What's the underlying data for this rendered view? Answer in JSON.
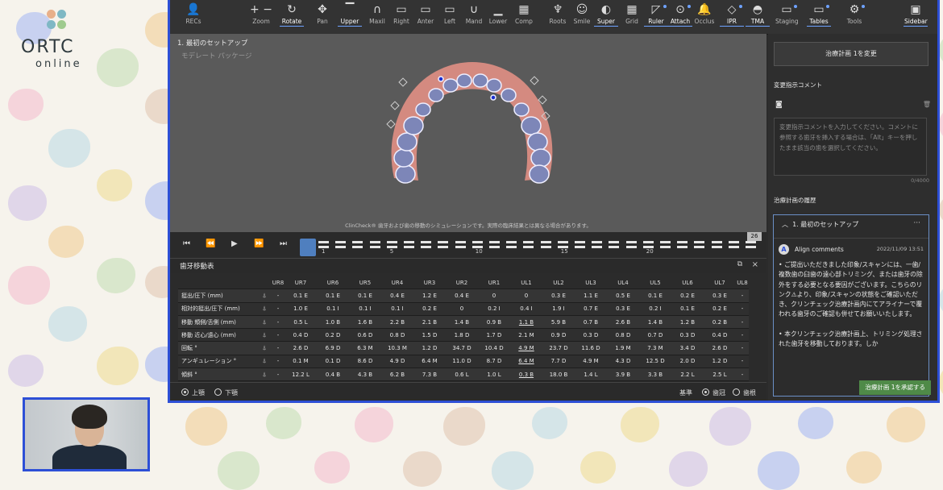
{
  "logo": {
    "word": "ORTC",
    "sub": "online"
  },
  "toolbar": {
    "items": [
      {
        "label": "RECs",
        "icon": "person-icon",
        "glyph": "👤"
      },
      {
        "label": "Zoom",
        "icon": "zoom-icon",
        "glyph": "+ −"
      },
      {
        "label": "Rotate",
        "icon": "rotate-icon",
        "glyph": "↻"
      },
      {
        "label": "Pan",
        "icon": "pan-icon",
        "glyph": "✥"
      },
      {
        "label": "Upper",
        "icon": "upper-jaw-icon",
        "glyph": "▔"
      },
      {
        "label": "Maxil",
        "icon": "maxilla-icon",
        "glyph": "∩"
      },
      {
        "label": "Right",
        "icon": "right-view-icon",
        "glyph": "▭"
      },
      {
        "label": "Anter",
        "icon": "anterior-view-icon",
        "glyph": "▭"
      },
      {
        "label": "Left",
        "icon": "left-view-icon",
        "glyph": "▭"
      },
      {
        "label": "Mand",
        "icon": "mandible-icon",
        "glyph": "∪"
      },
      {
        "label": "Lower",
        "icon": "lower-jaw-icon",
        "glyph": "▁"
      },
      {
        "label": "Comp",
        "icon": "compare-icon",
        "glyph": "▦"
      },
      {
        "label": "Roots",
        "icon": "roots-icon",
        "glyph": "♆"
      },
      {
        "label": "Smile",
        "icon": "smile-icon",
        "glyph": "☺"
      },
      {
        "label": "Super",
        "icon": "superimpose-icon",
        "glyph": "◐"
      },
      {
        "label": "Grid",
        "icon": "grid-icon",
        "glyph": "▦"
      },
      {
        "label": "Ruler",
        "icon": "ruler-icon",
        "glyph": "◸"
      },
      {
        "label": "Attach",
        "icon": "attach-icon",
        "glyph": "⊙"
      },
      {
        "label": "Occlus",
        "icon": "occlusion-icon",
        "glyph": "🔔"
      },
      {
        "label": "IPR",
        "icon": "ipr-icon",
        "glyph": "◇"
      },
      {
        "label": "TMA",
        "icon": "tma-icon",
        "glyph": "◓"
      },
      {
        "label": "Staging",
        "icon": "staging-icon",
        "glyph": "▭"
      },
      {
        "label": "Tables",
        "icon": "tables-icon",
        "glyph": "▭"
      },
      {
        "label": "Tools",
        "icon": "tools-icon",
        "glyph": "⚙"
      },
      {
        "label": "Sidebar",
        "icon": "sidebar-icon",
        "glyph": "▣"
      }
    ]
  },
  "viewport": {
    "title": "1. 最初のセットアップ",
    "subtitle": "モデレート パッケージ",
    "note": "ClinCheck® 歯牙および歯の移動のシミュレーションです。実際の臨床結果とは異なる場合があります。"
  },
  "timeline": {
    "labels": [
      "1",
      "5",
      "10",
      "15",
      "20"
    ],
    "end_stage": "26",
    "controls": [
      "⏮",
      "⏪",
      "▶",
      "⏩",
      "⏭"
    ]
  },
  "movement": {
    "title": "歯牙移動表",
    "columns": [
      "UR8",
      "UR7",
      "UR6",
      "UR5",
      "UR4",
      "UR3",
      "UR2",
      "UR1",
      "UL1",
      "UL2",
      "UL3",
      "UL4",
      "UL5",
      "UL6",
      "UL7",
      "UL8"
    ],
    "rows": [
      {
        "label": "挺出/圧下 (mm)",
        "icon": "⍋",
        "cells": [
          "-",
          "0.1 E",
          "0.1 E",
          "0.1 E",
          "0.4 E",
          "1.2 E",
          "0.4 E",
          "0",
          "0",
          "0.3 E",
          "1.1 E",
          "0.5 E",
          "0.1 E",
          "0.2 E",
          "0.3 E",
          "-"
        ]
      },
      {
        "label": "相対的挺出/圧下 (mm)",
        "icon": "⍋",
        "cells": [
          "-",
          "1.0 E",
          "0.1 I",
          "0.1 I",
          "0.1 I",
          "0.2 E",
          "0",
          "0.2 I",
          "0.4 I",
          "1.9 I",
          "0.7 E",
          "0.3 E",
          "0.2 I",
          "0.1 E",
          "0.2 E",
          "-"
        ]
      },
      {
        "label": "移動 頬側/舌側 (mm)",
        "icon": "⍋",
        "cells": [
          "-",
          "0.5 L",
          "1.0 B",
          "1.6 B",
          "2.2 B",
          "2.1 B",
          "1.4 B",
          "0.9 B",
          "1.1 B",
          "5.9 B",
          "0.7 B",
          "2.6 B",
          "1.4 B",
          "1.2 B",
          "0.2 B",
          "-"
        ]
      },
      {
        "label": "移動 近心/遠心 (mm)",
        "icon": "⍋",
        "cells": [
          "-",
          "0.4 D",
          "0.2 D",
          "0.6 D",
          "0.8 D",
          "1.5 D",
          "1.8 D",
          "1.7 D",
          "2.1 M",
          "0.9 D",
          "0.3 D",
          "0.8 D",
          "0.7 D",
          "0.3 D",
          "0.4 D",
          "-"
        ]
      },
      {
        "label": "回転 °",
        "icon": "⍋",
        "cells": [
          "-",
          "2.6 D",
          "6.9 D",
          "6.3 M",
          "10.3 M",
          "1.2 D",
          "34.7 D",
          "10.4 D",
          "4.9 M",
          "23.7 D",
          "11.6 D",
          "1.9 M",
          "7.3 M",
          "3.4 D",
          "2.6 D",
          "-"
        ]
      },
      {
        "label": "アンギュレーション °",
        "icon": "⍋",
        "cells": [
          "-",
          "0.1 M",
          "0.1 D",
          "8.6 D",
          "4.9 D",
          "6.4 M",
          "11.0 D",
          "8.7 D",
          "6.4 M",
          "7.7 D",
          "4.9 M",
          "4.3 D",
          "12.5 D",
          "2.0 D",
          "1.2 D",
          "-"
        ]
      },
      {
        "label": "傾斜 °",
        "icon": "⍋",
        "cells": [
          "-",
          "12.2 L",
          "0.4 B",
          "4.3 B",
          "6.2 B",
          "7.3 B",
          "0.6 L",
          "1.0 L",
          "0.3 B",
          "18.0 B",
          "1.4 L",
          "3.9 B",
          "3.3 B",
          "2.2 L",
          "2.5 L",
          "-"
        ]
      }
    ],
    "jaw_upper": "上顎",
    "jaw_lower": "下顎",
    "ref_label": "基準",
    "ref_crown": "歯冠",
    "ref_root": "歯根"
  },
  "sidebar": {
    "change_plan": "治療計画 1を変更",
    "comment_header": "変更指示コメント",
    "comment_placeholder": "変更指示コメントを入力してください。コメントに参照する歯牙を挿入する場合は、「Alt」キーを押したまま該当の歯を選択してください。",
    "char_count": "0/4000",
    "history_header": "治療計画の履歴",
    "history_title": "1. 最初のセットアップ",
    "author_initial": "A",
    "author": "Align comments",
    "date": "2022/11/09 13:51",
    "comment_body": "• ご提出いただきました印象/スキャンには、一歯/複数歯の臼歯の遠心部トリミング、または歯牙の除外をする必要となる要因がございます。こちらのリンク⚠より、印象/スキャンの状態をご確認いただき、クリンチェック治療計画内にてアライナーで覆われる歯牙のご確認も併せてお願いいたします。",
    "comment_body2": "• 本クリンチェック治療計画上、トリミング処理された歯牙を移動しております。しか",
    "approve": "治療計画 1を承認する"
  }
}
